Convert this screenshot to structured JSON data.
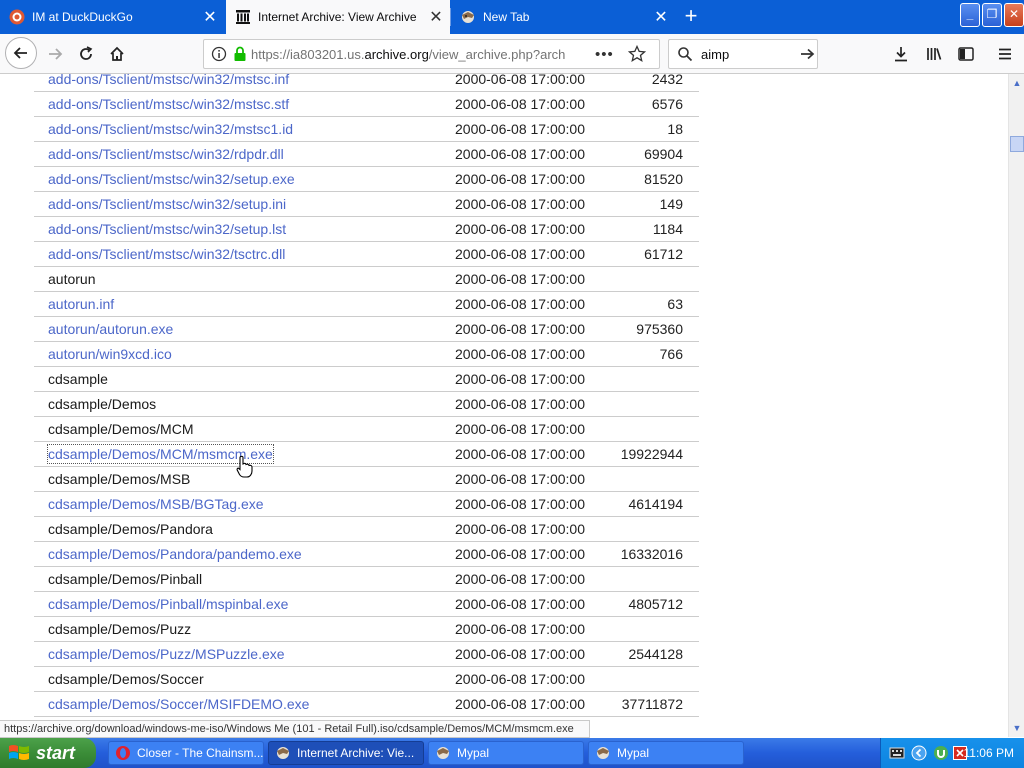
{
  "tabs": [
    {
      "title": "IM at DuckDuckGo",
      "icon": "duckduckgo-icon",
      "selected": false
    },
    {
      "title": "Internet Archive: View Archive",
      "icon": "archive-icon",
      "selected": true
    },
    {
      "title": "New Tab",
      "icon": "firefox-icon",
      "selected": false
    }
  ],
  "nav": {
    "url_prefix": "https://ia803201.us.",
    "url_domain": "archive.org",
    "url_suffix": "/view_archive.php?arch",
    "search_value": "aimp"
  },
  "files": [
    {
      "name": "add-ons/Tsclient/mstsc/win32/mstsc.inf",
      "date": "2000-06-08 17:00:00",
      "size": "2432",
      "link": true
    },
    {
      "name": "add-ons/Tsclient/mstsc/win32/mstsc.stf",
      "date": "2000-06-08 17:00:00",
      "size": "6576",
      "link": true
    },
    {
      "name": "add-ons/Tsclient/mstsc/win32/mstsc1.id",
      "date": "2000-06-08 17:00:00",
      "size": "18",
      "link": true
    },
    {
      "name": "add-ons/Tsclient/mstsc/win32/rdpdr.dll",
      "date": "2000-06-08 17:00:00",
      "size": "69904",
      "link": true
    },
    {
      "name": "add-ons/Tsclient/mstsc/win32/setup.exe",
      "date": "2000-06-08 17:00:00",
      "size": "81520",
      "link": true
    },
    {
      "name": "add-ons/Tsclient/mstsc/win32/setup.ini",
      "date": "2000-06-08 17:00:00",
      "size": "149",
      "link": true
    },
    {
      "name": "add-ons/Tsclient/mstsc/win32/setup.lst",
      "date": "2000-06-08 17:00:00",
      "size": "1184",
      "link": true
    },
    {
      "name": "add-ons/Tsclient/mstsc/win32/tsctrc.dll",
      "date": "2000-06-08 17:00:00",
      "size": "61712",
      "link": true
    },
    {
      "name": "autorun",
      "date": "2000-06-08 17:00:00",
      "size": "",
      "link": false
    },
    {
      "name": "autorun.inf",
      "date": "2000-06-08 17:00:00",
      "size": "63",
      "link": true
    },
    {
      "name": "autorun/autorun.exe",
      "date": "2000-06-08 17:00:00",
      "size": "975360",
      "link": true
    },
    {
      "name": "autorun/win9xcd.ico",
      "date": "2000-06-08 17:00:00",
      "size": "766",
      "link": true
    },
    {
      "name": "cdsample",
      "date": "2000-06-08 17:00:00",
      "size": "",
      "link": false
    },
    {
      "name": "cdsample/Demos",
      "date": "2000-06-08 17:00:00",
      "size": "",
      "link": false
    },
    {
      "name": "cdsample/Demos/MCM",
      "date": "2000-06-08 17:00:00",
      "size": "",
      "link": false
    },
    {
      "name": "cdsample/Demos/MCM/msmcm.exe",
      "date": "2000-06-08 17:00:00",
      "size": "19922944",
      "link": true,
      "focused": true
    },
    {
      "name": "cdsample/Demos/MSB",
      "date": "2000-06-08 17:00:00",
      "size": "",
      "link": false
    },
    {
      "name": "cdsample/Demos/MSB/BGTag.exe",
      "date": "2000-06-08 17:00:00",
      "size": "4614194",
      "link": true
    },
    {
      "name": "cdsample/Demos/Pandora",
      "date": "2000-06-08 17:00:00",
      "size": "",
      "link": false
    },
    {
      "name": "cdsample/Demos/Pandora/pandemo.exe",
      "date": "2000-06-08 17:00:00",
      "size": "16332016",
      "link": true
    },
    {
      "name": "cdsample/Demos/Pinball",
      "date": "2000-06-08 17:00:00",
      "size": "",
      "link": false
    },
    {
      "name": "cdsample/Demos/Pinball/mspinbal.exe",
      "date": "2000-06-08 17:00:00",
      "size": "4805712",
      "link": true
    },
    {
      "name": "cdsample/Demos/Puzz",
      "date": "2000-06-08 17:00:00",
      "size": "",
      "link": false
    },
    {
      "name": "cdsample/Demos/Puzz/MSPuzzle.exe",
      "date": "2000-06-08 17:00:00",
      "size": "2544128",
      "link": true
    },
    {
      "name": "cdsample/Demos/Soccer",
      "date": "2000-06-08 17:00:00",
      "size": "",
      "link": false
    },
    {
      "name": "cdsample/Demos/Soccer/MSIFDEMO.exe",
      "date": "2000-06-08 17:00:00",
      "size": "37711872",
      "link": true
    },
    {
      "name": "cdsample/Demos/Soccer",
      "date": "2000-06-08 17:00:00",
      "size": "",
      "link": false
    }
  ],
  "status_url": "https://archive.org/download/windows-me-iso/Windows Me (101 - Retail Full).iso/cdsample/Demos/MCM/msmcm.exe",
  "taskbar": {
    "start_label": "start",
    "tasks": [
      {
        "label": "Closer - The Chainsm...",
        "icon": "opera-icon",
        "active": false
      },
      {
        "label": "Internet Archive: Vie...",
        "icon": "firefox-icon",
        "active": true
      },
      {
        "label": "Mypal",
        "icon": "mypal-icon",
        "active": false
      },
      {
        "label": "Mypal",
        "icon": "mypal-icon",
        "active": false
      }
    ],
    "clock": "11:06 PM"
  }
}
